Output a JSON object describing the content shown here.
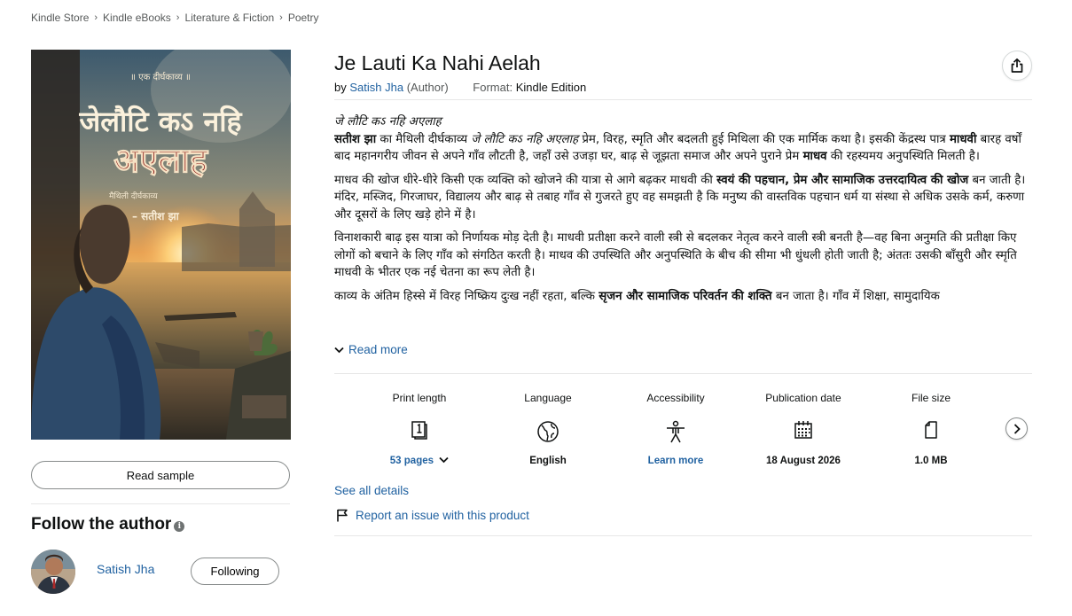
{
  "breadcrumb": [
    "Kindle Store",
    "Kindle eBooks",
    "Literature & Fiction",
    "Poetry"
  ],
  "breadcrumb_sep": "›",
  "cover": {
    "top_text": "॥ एक दीर्घकाव्य ॥",
    "title_line1": "जेलौटि कऽ नहि",
    "title_line2": "अएलाह",
    "subtitle": "मैथिली दीर्घकाव्य",
    "author": "– सतीश झा"
  },
  "read_sample": "Read sample",
  "follow_author": {
    "title": "Follow the author",
    "info_icon": "i",
    "author_name": "Satish Jha",
    "following_label": "Following"
  },
  "book": {
    "title": "Je Lauti Ka Nahi Aelah",
    "by": "by",
    "author": "Satish Jha",
    "author_role": "(Author)",
    "format_label": "Format:",
    "format_value": "Kindle Edition"
  },
  "description": {
    "line_title": "जे लौटि कऽ नहि अएलाह",
    "p1_a": "सतीश झा",
    "p1_b": " का मैथिली दीर्घकाव्य ",
    "p1_c": "जे लौटि कऽ नहि अएलाह",
    "p1_d": " प्रेम, विरह, स्मृति और बदलती हुई मिथिला की एक मार्मिक कथा है। इसकी केंद्रस्थ पात्र ",
    "p1_e": "माधवी",
    "p1_f": " बारह वर्षों बाद महानगरीय जीवन से अपने गाँव लौटती है, जहाँ उसे उजड़ा घर, बाढ़ से जूझता समाज और अपने पुराने प्रेम ",
    "p1_g": "माधव",
    "p1_h": " की रहस्यमय अनुपस्थिति मिलती है।",
    "p2_a": "माधव की खोज धीरे-धीरे किसी एक व्यक्ति को खोजने की यात्रा से आगे बढ़कर माधवी की ",
    "p2_b": "स्वयं की पहचान, प्रेम और सामाजिक उत्तरदायित्व की खोज",
    "p2_c": " बन जाती है। मंदिर, मस्जिद, गिरजाघर, विद्यालय और बाढ़ से तबाह गाँव से गुजरते हुए वह समझती है कि मनुष्य की वास्तविक पहचान धर्म या संस्था से अधिक उसके कर्म, करुणा और दूसरों के लिए खड़े होने में है।",
    "p3": "विनाशकारी बाढ़ इस यात्रा को निर्णायक मोड़ देती है। माधवी प्रतीक्षा करने वाली स्त्री से बदलकर नेतृत्व करने वाली स्त्री बनती है—वह बिना अनुमति की प्रतीक्षा किए लोगों को बचाने के लिए गाँव को संगठित करती है। माधव की उपस्थिति और अनुपस्थिति के बीच की सीमा भी धुंधली होती जाती है; अंततः उसकी बाँसुरी और स्मृति माधवी के भीतर एक नई चेतना का रूप लेती है।",
    "p4_a": "काव्य के अंतिम हिस्से में विरह निष्क्रिय दुःख नहीं रहता, बल्कि ",
    "p4_b": "सृजन और सामाजिक परिवर्तन की शक्ति",
    "p4_c": " बन जाता है। गाँव में शिक्षा, सामुदायिक"
  },
  "read_more": "Read more",
  "details": [
    {
      "label": "Print length",
      "value": "53 pages",
      "icon": "pages-icon",
      "link": true
    },
    {
      "label": "Language",
      "value": "English",
      "icon": "globe-icon",
      "link": false
    },
    {
      "label": "Accessibility",
      "value": "Learn more",
      "icon": "accessibility-icon",
      "link": true
    },
    {
      "label": "Publication date",
      "value": "18 August 2026",
      "icon": "calendar-icon",
      "link": false
    },
    {
      "label": "File size",
      "value": "1.0 MB",
      "icon": "file-icon",
      "link": false
    }
  ],
  "see_all_details": "See all details",
  "report_issue": "Report an issue with this product",
  "colors": {
    "link": "#2162a1",
    "text": "#0f1111",
    "muted": "#565959",
    "divider": "#e7e7e7"
  }
}
